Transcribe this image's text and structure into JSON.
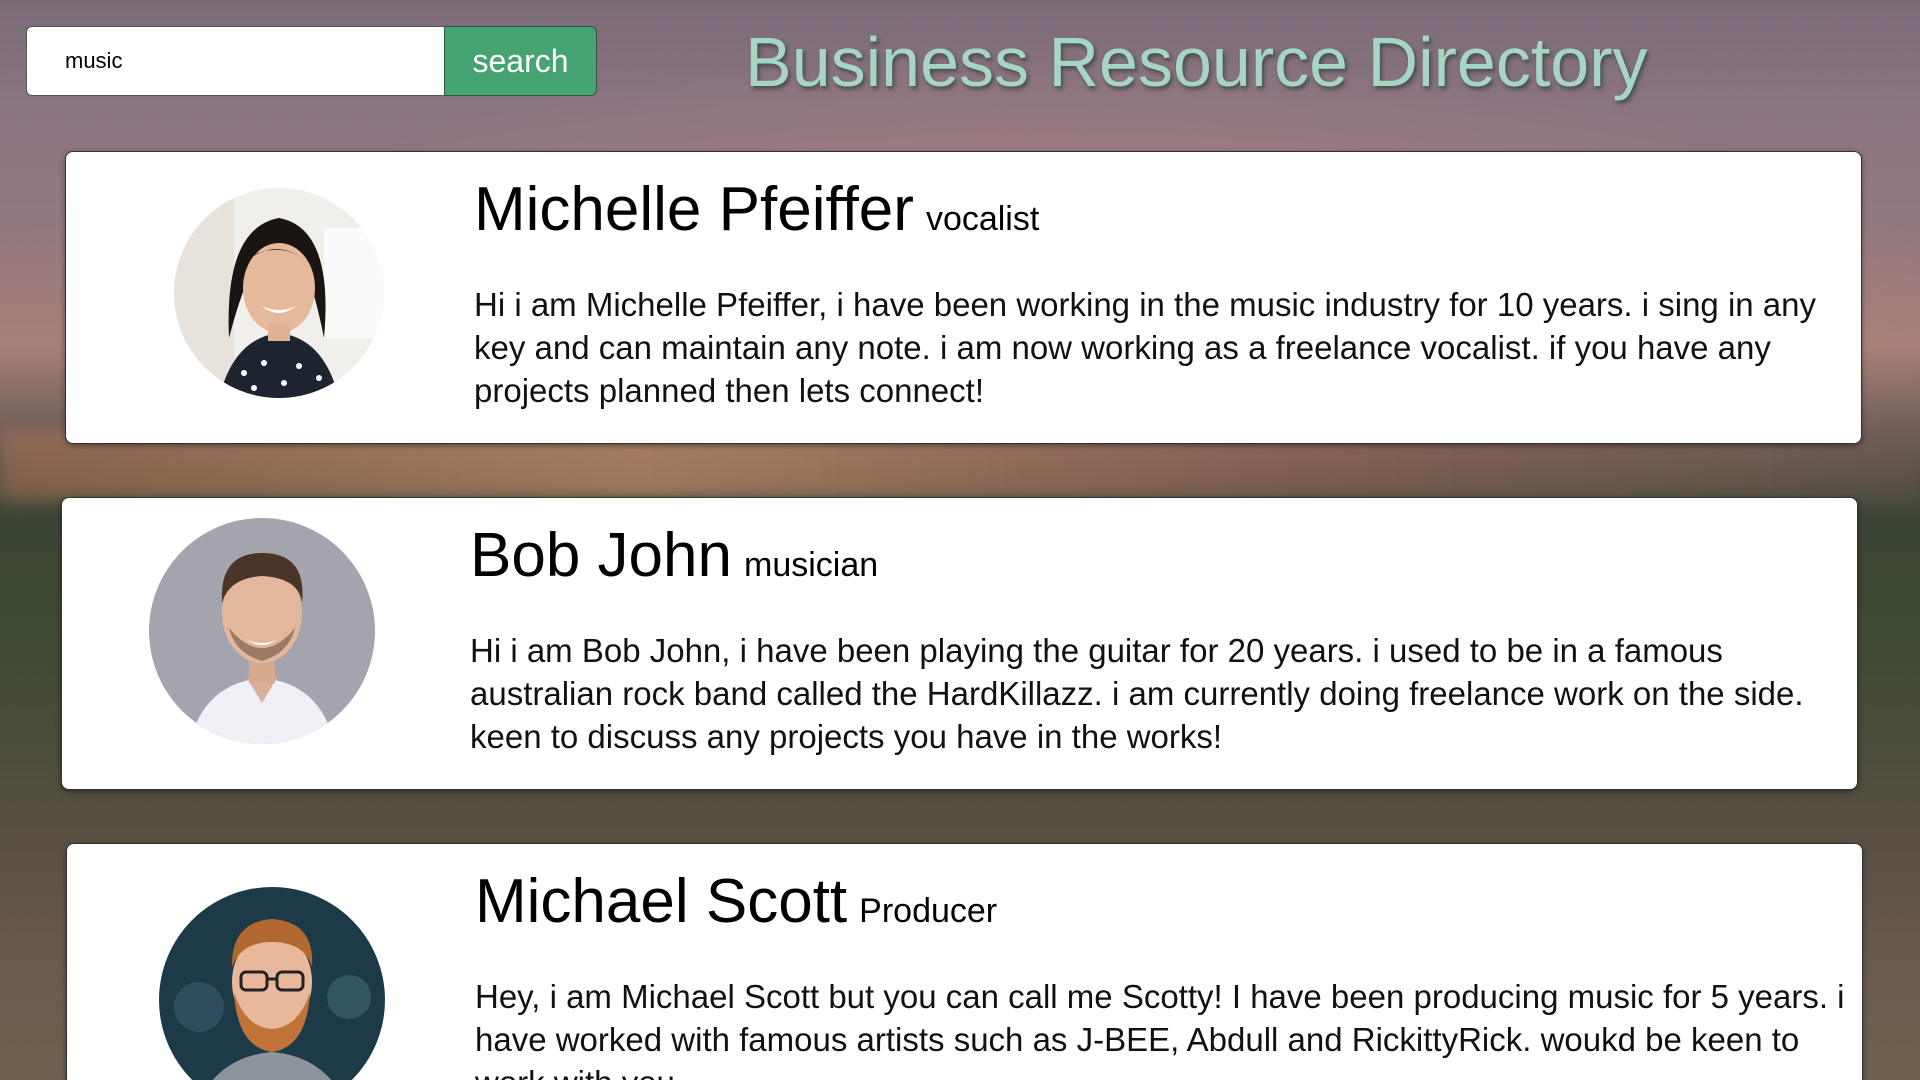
{
  "search": {
    "value": "music",
    "button_label": "search"
  },
  "page_title": "Business Resource Directory",
  "profiles": [
    {
      "name": "Michelle Pfeiffer",
      "role": "vocalist",
      "bio": "Hi i am Michelle Pfeiffer, i have been working in the music industry for 10 years. i sing in any key and can maintain any note. i am now working as a freelance vocalist. if you have any projects planned then lets connect!"
    },
    {
      "name": "Bob John",
      "role": "musician",
      "bio": "Hi i am Bob John, i have been playing the guitar for 20 years. i used to be in a famous australian rock band called the HardKillazz. i am currently doing freelance work on the side. keen to discuss any projects you have in the works!"
    },
    {
      "name": "Michael Scott",
      "role": "Producer",
      "bio": "Hey, i am Michael Scott but you can call me Scotty! I have been producing music for 5 years. i have worked with famous artists such as J-BEE, Abdull and RickittyRick. woukd be keen to  work with you"
    }
  ]
}
